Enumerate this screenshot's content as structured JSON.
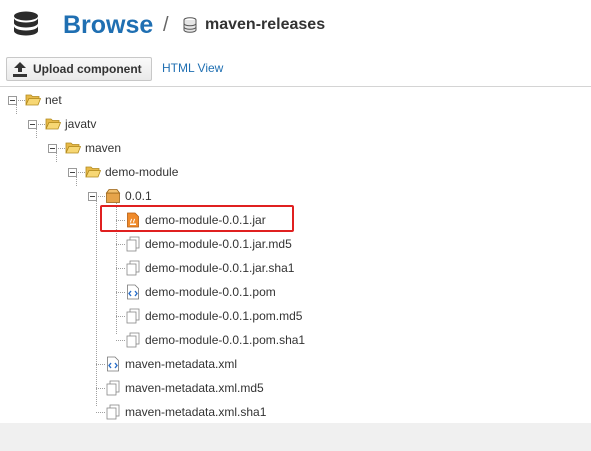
{
  "header": {
    "title": "Browse",
    "separator": "/",
    "repo_name": "maven-releases"
  },
  "toolbar": {
    "upload_label": "Upload component",
    "html_view_label": "HTML View"
  },
  "tree": {
    "net": "net",
    "javatv": "javatv",
    "maven": "maven",
    "demo_module": "demo-module",
    "version": "0.0.1",
    "files": [
      "demo-module-0.0.1.jar",
      "demo-module-0.0.1.jar.md5",
      "demo-module-0.0.1.jar.sha1",
      "demo-module-0.0.1.pom",
      "demo-module-0.0.1.pom.md5",
      "demo-module-0.0.1.pom.sha1"
    ],
    "metadata": [
      "maven-metadata.xml",
      "maven-metadata.xml.md5",
      "maven-metadata.xml.sha1"
    ]
  },
  "colors": {
    "accent": "#1f6fb2",
    "highlight": "#e02020",
    "folder": "#f2c94c",
    "jar": "#e8751a"
  }
}
